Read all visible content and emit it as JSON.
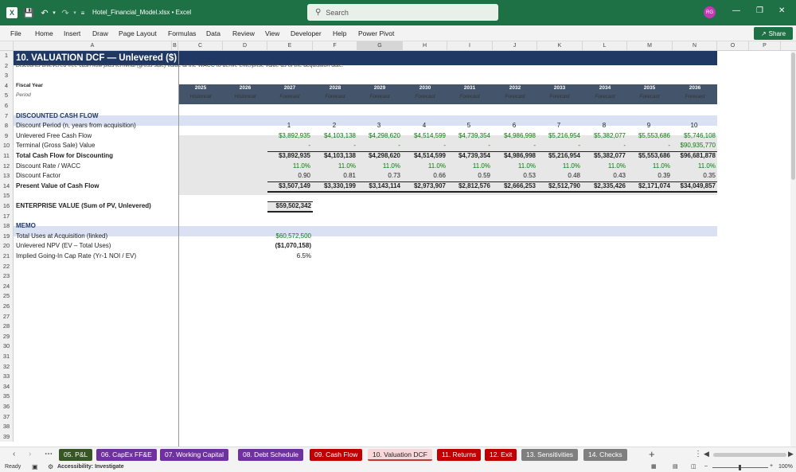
{
  "app": {
    "filename": "Hotel_Financial_Model.xlsx",
    "app_name": "Excel",
    "search_placeholder": "Search",
    "avatar_initials": "RG"
  },
  "ribbon_tabs": [
    "File",
    "Home",
    "Insert",
    "Draw",
    "Page Layout",
    "Formulas",
    "Data",
    "Review",
    "View",
    "Developer",
    "Help",
    "Power Pivot"
  ],
  "share_label": "Share",
  "columns": [
    "A",
    "B",
    "C",
    "D",
    "E",
    "F",
    "G",
    "H",
    "I",
    "J",
    "K",
    "L",
    "M",
    "N",
    "O",
    "P"
  ],
  "selected_column": "G",
  "row_numbers": [
    "1",
    "2",
    "3",
    "4",
    "5",
    "6",
    "7",
    "8",
    "9",
    "10",
    "11",
    "12",
    "13",
    "14",
    "15",
    "16",
    "17",
    "18",
    "19",
    "20",
    "21",
    "22",
    "23",
    "24",
    "25",
    "26",
    "27",
    "28",
    "29",
    "30",
    "31",
    "32",
    "33",
    "34",
    "35",
    "36",
    "37",
    "38",
    "39"
  ],
  "sheet": {
    "title": "10. VALUATION DCF — Unlevered ($)",
    "subtitle": "Discounts unlevered free cash flow plus terminal (gross sale) value at the WACC to derive enterprise value as of the acquisition date.",
    "fiscal_year_label": "Fiscal Year",
    "period_label": "Period",
    "years": [
      "2025",
      "2026",
      "2027",
      "2028",
      "2029",
      "2030",
      "2031",
      "2032",
      "2033",
      "2034",
      "2035",
      "2036"
    ],
    "periods": [
      "Historical",
      "Historical",
      "Forecast",
      "Forecast",
      "Forecast",
      "Forecast",
      "Forecast",
      "Forecast",
      "Forecast",
      "Forecast",
      "Forecast",
      "Forecast"
    ],
    "section_dcf": "DISCOUNTED CASH FLOW",
    "rows": [
      {
        "label": "Discount Period (n, years from acquisition)",
        "values": [
          "1",
          "2",
          "3",
          "4",
          "5",
          "6",
          "7",
          "8",
          "9",
          "10"
        ]
      },
      {
        "label": "Unlevered Free Cash Flow",
        "values": [
          "$3,892,935",
          "$4,103,138",
          "$4,298,620",
          "$4,514,599",
          "$4,739,354",
          "$4,986,998",
          "$5,216,954",
          "$5,382,077",
          "$5,553,686",
          "$5,746,108"
        ]
      },
      {
        "label": "Terminal (Gross Sale) Value",
        "values": [
          "-",
          "-",
          "-",
          "-",
          "-",
          "-",
          "-",
          "-",
          "-",
          "$90,935,770"
        ]
      },
      {
        "label": "Total Cash Flow for Discounting",
        "values": [
          "$3,892,935",
          "$4,103,138",
          "$4,298,620",
          "$4,514,599",
          "$4,739,354",
          "$4,986,998",
          "$5,216,954",
          "$5,382,077",
          "$5,553,686",
          "$96,681,878"
        ]
      },
      {
        "label": "Discount Rate / WACC",
        "values": [
          "11.0%",
          "11.0%",
          "11.0%",
          "11.0%",
          "11.0%",
          "11.0%",
          "11.0%",
          "11.0%",
          "11.0%",
          "11.0%"
        ]
      },
      {
        "label": "Discount Factor",
        "values": [
          "0.90",
          "0.81",
          "0.73",
          "0.66",
          "0.59",
          "0.53",
          "0.48",
          "0.43",
          "0.39",
          "0.35"
        ]
      },
      {
        "label": "Present Value of Cash Flow",
        "values": [
          "$3,507,149",
          "$3,330,199",
          "$3,143,114",
          "$2,973,907",
          "$2,812,576",
          "$2,666,253",
          "$2,512,790",
          "$2,335,426",
          "$2,171,074",
          "$34,049,857"
        ]
      }
    ],
    "ev_label": "ENTERPRISE VALUE (Sum of PV, Unlevered)",
    "ev_value": "$59,502,342",
    "section_memo": "MEMO",
    "memo": [
      {
        "label": "Total Uses at Acquisition (linked)",
        "value": "$60,572,500"
      },
      {
        "label": "Unlevered NPV (EV – Total Uses)",
        "value": "($1,070,158)"
      },
      {
        "label": "Implied Going-In Cap Rate (Yr-1 NOI / EV)",
        "value": "6.5%"
      }
    ]
  },
  "sheet_tabs": [
    {
      "label": "05. P&L",
      "color": "#375623"
    },
    {
      "label": "06. CapEx FF&E",
      "color": "#7030a0"
    },
    {
      "label": "07. Working Capital",
      "color": "#7030a0"
    },
    {
      "label": "08. Debt Schedule",
      "color": "#7030a0"
    },
    {
      "label": "09. Cash Flow",
      "color": "#c00000"
    },
    {
      "label": "10. Valuation DCF",
      "color": "#c00000"
    },
    {
      "label": "11. Returns",
      "color": "#c00000"
    },
    {
      "label": "12. Exit",
      "color": "#c00000"
    },
    {
      "label": "13. Sensitivities",
      "color": "#7f7f7f"
    },
    {
      "label": "14. Checks",
      "color": "#7f7f7f"
    }
  ],
  "status": {
    "ready": "Ready",
    "accessibility": "Accessibility: Investigate",
    "zoom": "100%"
  }
}
